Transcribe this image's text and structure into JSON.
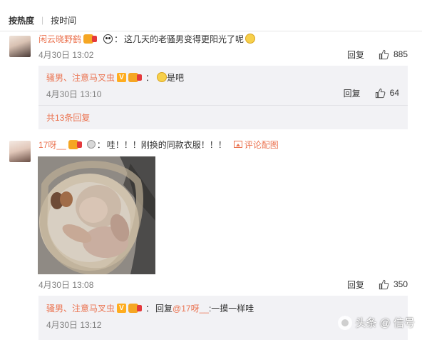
{
  "sort": {
    "hot": "按热度",
    "time": "按时间"
  },
  "comments": [
    {
      "user": "闲云晓野鹤",
      "text": "这几天的老骚男变得更阳光了呢",
      "time": "4月30日 13:02",
      "reply_label": "回复",
      "likes": "885",
      "replies": [
        {
          "user": "骚男、注意马叉虫",
          "text": "是吧",
          "time": "4月30日 13:10",
          "reply_label": "回复",
          "likes": "64"
        }
      ],
      "more": "共13条回复"
    },
    {
      "user": "17呀__",
      "text": "哇！！！刚换的同款衣服！！！",
      "photo_link": "评论配图",
      "time": "4月30日 13:08",
      "reply_label": "回复",
      "likes": "350",
      "replies": [
        {
          "user": "骚男、注意马叉虫",
          "text": "回复",
          "mention": "@17呀__",
          "text_after": ":一摸一样哇",
          "time": "4月30日 13:12"
        }
      ]
    }
  ],
  "watermark": "头条 @ 信号",
  "icons": [
    "thumbs-up-icon",
    "panda-icon",
    "emoji-icon",
    "picture-icon",
    "vip-badge-icon",
    "medal-icon"
  ],
  "colors": {
    "accent": "#eb7350",
    "reply_bg": "#f2f2f5",
    "muted": "#808080"
  }
}
